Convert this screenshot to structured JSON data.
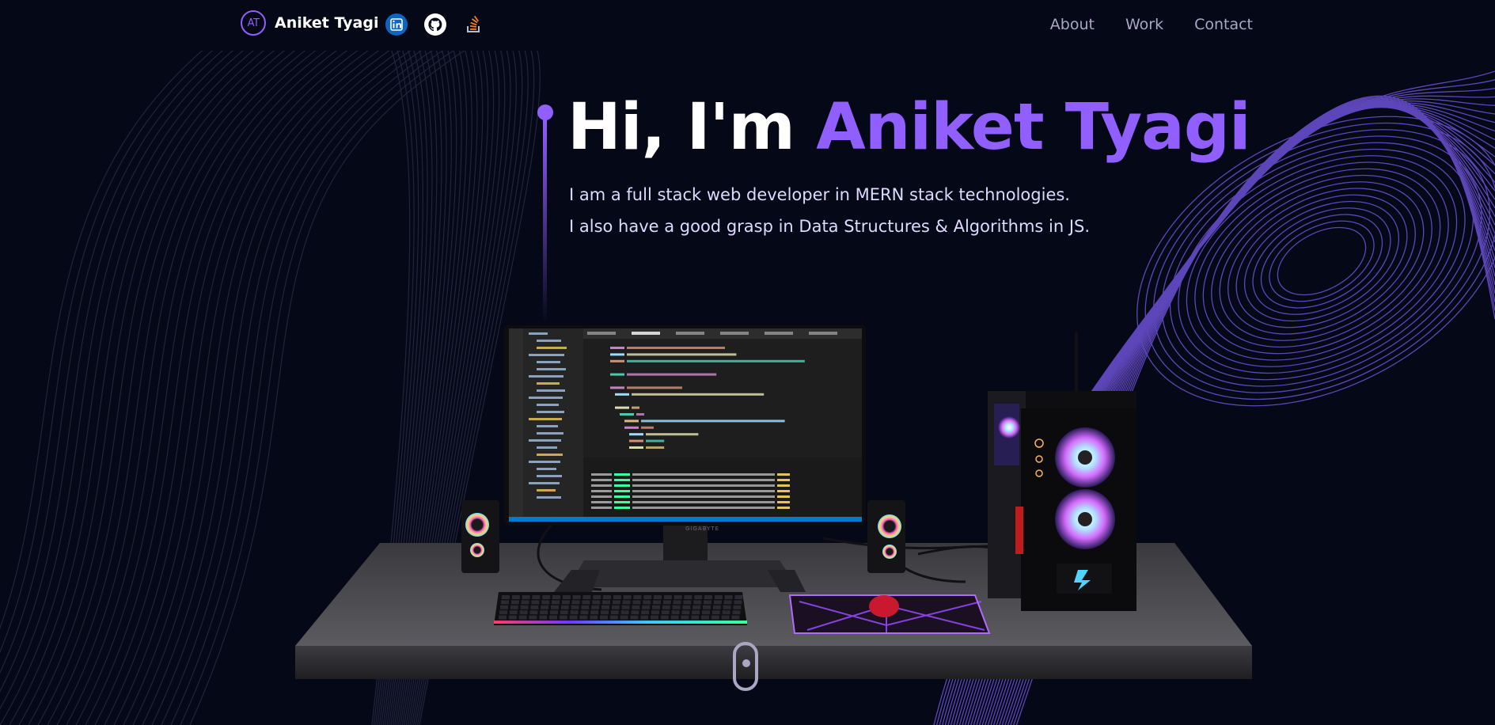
{
  "navbar": {
    "logo_text": "AT",
    "brand_name": "Aniket Tyagi",
    "links": [
      "About",
      "Work",
      "Contact"
    ],
    "socials": [
      "linkedin-icon",
      "github-icon",
      "stack-overflow-icon"
    ]
  },
  "hero": {
    "greeting": "Hi, I'm",
    "name": "Aniket Tyagi",
    "line1": "I am a full stack web developer in MERN stack technologies.",
    "line2": "I also have a good grasp in Data Structures & Algorithms in JS."
  },
  "scene": {
    "monitor_brand": "GIGABYTE",
    "code_lines": [
      "import React, { Suspense } from \"react\";",
      "import { Canvas } from \"@react-three/fiber\";",
      "import { OrbitControls, Preload, useGLTF } from \"@react-three/drei\";",
      "",
      "import CanvasLoader from \"../Loader\";",
      "",
      "const Computers = () => {",
      "  const computer = useGLTF(\"./desktop_pc/scene.gltf\");",
      "",
      "  return (",
      "    <mesh>",
      "      <hemisphereLight intensity={0.15} groundColor='black' />",
      "      <spotLight",
      "        position={[-20, 50, 10]}",
      "        angle={0.12}",
      "        penumbra={1}"
    ]
  },
  "colors": {
    "background": "#050816",
    "accent": "#915EFF",
    "secondary": "#aaa6c3"
  }
}
